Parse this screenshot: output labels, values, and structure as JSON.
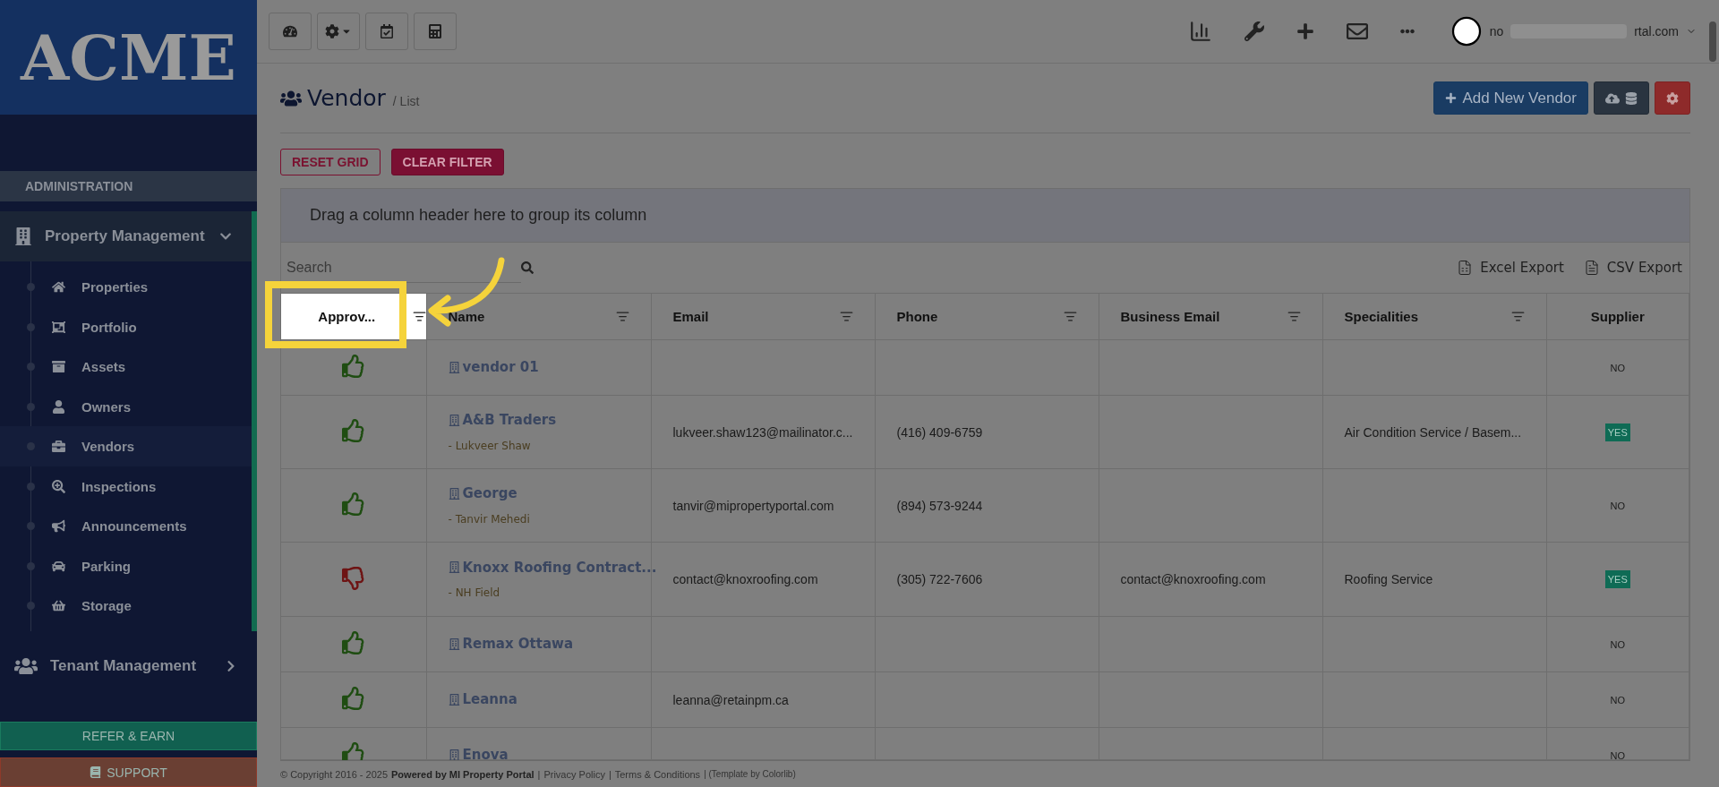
{
  "sidebar": {
    "logo": "ACME",
    "section": "ADMINISTRATION",
    "groups": [
      {
        "label": "Property Management",
        "expanded": true,
        "children": [
          {
            "label": "Properties",
            "selected": false
          },
          {
            "label": "Portfolio",
            "selected": false
          },
          {
            "label": "Assets",
            "selected": false
          },
          {
            "label": "Owners",
            "selected": false
          },
          {
            "label": "Vendors",
            "selected": true
          },
          {
            "label": "Inspections",
            "selected": false
          },
          {
            "label": "Announcements",
            "selected": false
          },
          {
            "label": "Parking",
            "selected": false
          },
          {
            "label": "Storage",
            "selected": false
          }
        ]
      },
      {
        "label": "Tenant Management",
        "expanded": false
      }
    ],
    "refer_button": "REFER & EARN",
    "support_button": "SUPPORT"
  },
  "topbar": {
    "user_email_start": "no",
    "user_email_end": "rtal.com"
  },
  "page": {
    "title": "Vendor",
    "breadcrumb": "/ List",
    "add_button": "Add New Vendor",
    "reset_button": "RESET GRID",
    "clear_button": "CLEAR FILTER",
    "group_panel": "Drag a column header here to group its column",
    "search_placeholder": "Search",
    "excel_export": "Excel Export",
    "csv_export": "CSV Export"
  },
  "table": {
    "columns": [
      {
        "label": "Approv...",
        "filter": true,
        "highlighted": true
      },
      {
        "label": "Name",
        "filter": true,
        "highlighted": false
      },
      {
        "label": "Email",
        "filter": true,
        "highlighted": false
      },
      {
        "label": "Phone",
        "filter": true,
        "highlighted": false
      },
      {
        "label": "Business Email",
        "filter": true,
        "highlighted": false
      },
      {
        "label": "Specialities",
        "filter": true,
        "highlighted": false
      },
      {
        "label": "Supplier",
        "filter": false,
        "highlighted": false
      }
    ],
    "rows": [
      {
        "approved": true,
        "name": "vendor 01",
        "contact": "",
        "email": "",
        "phone": "",
        "business_email": "",
        "specialities": "",
        "supplier": "NO",
        "supplier_badge": false
      },
      {
        "approved": true,
        "name": "A&B Traders",
        "contact": "- Lukveer Shaw",
        "email": "lukveer.shaw123@mailinator.c...",
        "phone": "(416) 409-6759",
        "business_email": "",
        "specialities": "Air Condition Service / Basem...",
        "supplier": "YES",
        "supplier_badge": true
      },
      {
        "approved": true,
        "name": "George",
        "contact": "- Tanvir Mehedi",
        "email": "tanvir@mipropertyportal.com",
        "phone": "(894) 573-9244",
        "business_email": "",
        "specialities": "",
        "supplier": "NO",
        "supplier_badge": false
      },
      {
        "approved": false,
        "name": "Knoxx Roofing Contract...",
        "contact": "- NH Field",
        "email": "contact@knoxroofing.com",
        "phone": "(305) 722-7606",
        "business_email": "contact@knoxroofing.com",
        "specialities": "Roofing Service",
        "supplier": "YES",
        "supplier_badge": true
      },
      {
        "approved": true,
        "name": "Remax Ottawa",
        "contact": "",
        "email": "",
        "phone": "",
        "business_email": "",
        "specialities": "",
        "supplier": "NO",
        "supplier_badge": false
      },
      {
        "approved": true,
        "name": "Leanna",
        "contact": "",
        "email": "leanna@retainpm.ca",
        "phone": "",
        "business_email": "",
        "specialities": "",
        "supplier": "NO",
        "supplier_badge": false
      },
      {
        "approved": true,
        "name": "Enova",
        "contact": "",
        "email": "",
        "phone": "",
        "business_email": "",
        "specialities": "",
        "supplier": "NO",
        "supplier_badge": false
      }
    ]
  },
  "footer": [
    {
      "kind": "text",
      "text": "© Copyright 2016 - 2025"
    },
    {
      "kind": "strong",
      "text": "Powered by MI Property Portal"
    },
    {
      "kind": "text",
      "text": "|"
    },
    {
      "kind": "link",
      "text": "Privacy Policy"
    },
    {
      "kind": "text",
      "text": "|"
    },
    {
      "kind": "link",
      "text": "Terms & Conditions"
    },
    {
      "kind": "small",
      "text": "| (Template by Colorlib)"
    }
  ]
}
